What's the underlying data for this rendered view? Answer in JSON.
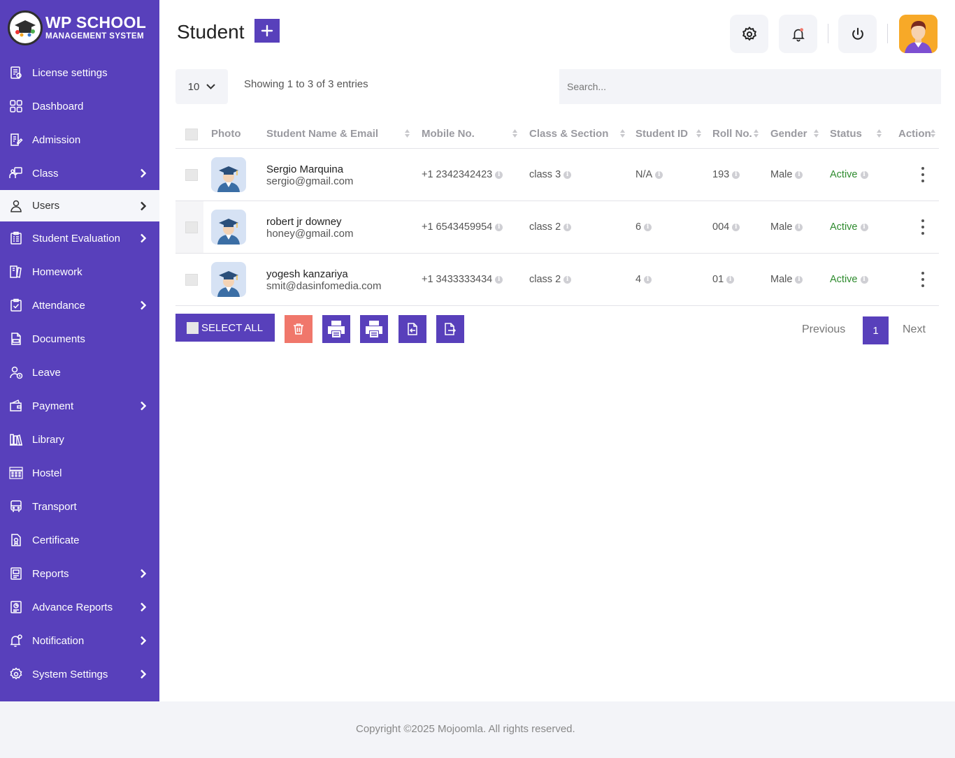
{
  "brand": {
    "title": "WP SCHOOL",
    "subtitle": "MANAGEMENT SYSTEM"
  },
  "sidebar": {
    "items": [
      {
        "label": "License settings",
        "icon": "license-icon",
        "chevron": false
      },
      {
        "label": "Dashboard",
        "icon": "dashboard-icon",
        "chevron": false
      },
      {
        "label": "Admission",
        "icon": "admission-icon",
        "chevron": false
      },
      {
        "label": "Class",
        "icon": "class-icon",
        "chevron": true
      },
      {
        "label": "Users",
        "icon": "user-icon",
        "chevron": true,
        "active": true
      },
      {
        "label": "Student Evaluation",
        "icon": "evaluation-icon",
        "chevron": true
      },
      {
        "label": "Homework",
        "icon": "homework-icon",
        "chevron": false
      },
      {
        "label": "Attendance",
        "icon": "attendance-icon",
        "chevron": true
      },
      {
        "label": "Documents",
        "icon": "documents-icon",
        "chevron": false
      },
      {
        "label": "Leave",
        "icon": "leave-icon",
        "chevron": false
      },
      {
        "label": "Payment",
        "icon": "wallet-icon",
        "chevron": true
      },
      {
        "label": "Library",
        "icon": "library-icon",
        "chevron": false
      },
      {
        "label": "Hostel",
        "icon": "hostel-icon",
        "chevron": false
      },
      {
        "label": "Transport",
        "icon": "bus-icon",
        "chevron": false
      },
      {
        "label": "Certificate",
        "icon": "certificate-icon",
        "chevron": false
      },
      {
        "label": "Reports",
        "icon": "reports-icon",
        "chevron": true
      },
      {
        "label": "Advance Reports",
        "icon": "advance-reports-icon",
        "chevron": true
      },
      {
        "label": "Notification",
        "icon": "notification-icon",
        "chevron": true
      },
      {
        "label": "System Settings",
        "icon": "settings-icon",
        "chevron": true
      }
    ]
  },
  "header": {
    "title": "Student"
  },
  "controls": {
    "page_length": "10",
    "info": "Showing 1 to 3 of 3 entries",
    "search_placeholder": "Search..."
  },
  "table": {
    "columns": [
      "Photo",
      "Student Name & Email",
      "Mobile No.",
      "Class & Section",
      "Student ID",
      "Roll No.",
      "Gender",
      "Status",
      "Action"
    ],
    "rows": [
      {
        "name": "Sergio Marquina",
        "email": "sergio@gmail.com",
        "mobile": "+1 2342342423",
        "class": "class 3",
        "student_id": "N/A",
        "roll": "193",
        "gender": "Male",
        "status": "Active"
      },
      {
        "name": "robert jr downey",
        "email": "honey@gmail.com",
        "mobile": "+1 6543459954",
        "class": "class 2",
        "student_id": "6",
        "roll": "004",
        "gender": "Male",
        "status": "Active"
      },
      {
        "name": "yogesh kanzariya",
        "email": "smit@dasinfomedia.com",
        "mobile": "+1 3433333434",
        "class": "class 2",
        "student_id": "4",
        "roll": "01",
        "gender": "Male",
        "status": "Active"
      }
    ]
  },
  "actions": {
    "select_all": "SELECT ALL"
  },
  "pager": {
    "previous": "Previous",
    "current": "1",
    "next": "Next"
  },
  "footer": {
    "copyright": "Copyright ©2025 Mojoomla. All rights reserved."
  },
  "colors": {
    "primary": "#5840bb",
    "delete": "#f0776b",
    "status_active": "#2e8b2e",
    "surface": "#f3f4f8"
  }
}
